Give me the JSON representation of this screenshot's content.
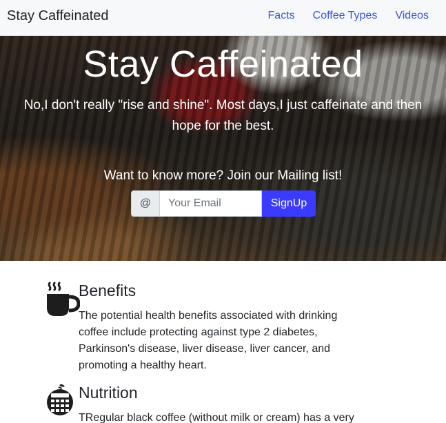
{
  "navbar": {
    "brand": "Stay Caffeinated",
    "links": [
      "Facts",
      "Coffee Types",
      "Videos"
    ]
  },
  "hero": {
    "title": "Stay Caffeinated",
    "subtitle": "No,I don't really \"rise and shine\". Most days,I just caffeinate and then hope for the best.",
    "cta": "Want to know more? Join our Mailing list!",
    "signup": {
      "addon": "@",
      "placeholder": "Your Email",
      "button": "SignUp"
    }
  },
  "features": [
    {
      "title": "Benefits",
      "icon": "coffee-cup-icon",
      "text": "The potential health benefits associated with drinking coffee include protecting against type 2 diabetes, Parkinson's disease, liver disease, liver cancer, and promoting a healthy heart."
    },
    {
      "title": "Nutrition",
      "icon": "apple-calculator-icon",
      "text": "TRegular black coffee (without milk or cream) has a very"
    }
  ],
  "colors": {
    "link": "#3a55d9",
    "button": "#3b3bff"
  }
}
